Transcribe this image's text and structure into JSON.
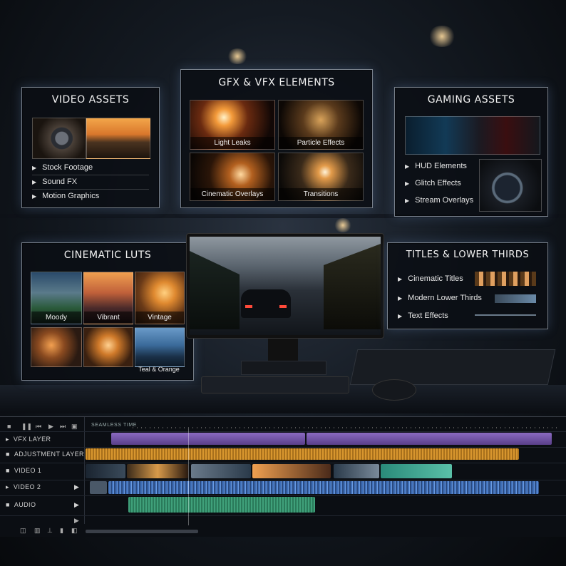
{
  "colors": {
    "accent": "#ffb25a",
    "panel_border": "#d2dceb",
    "vfx_clip": "#7b5fb0",
    "adjust_clip": "#c98a2a",
    "video2_clip": "#3f6fb8",
    "audio_clip": "#3fa07a"
  },
  "video_assets": {
    "title": "VIDEO ASSETS",
    "items": [
      "Stock Footage",
      "Sound FX",
      "Motion Graphics"
    ]
  },
  "gfx_vfx": {
    "title": "GFX & VFX ELEMENTS",
    "thumbs": [
      "Light Leaks",
      "Particle Effects",
      "Cinematic Overlays",
      "Transitions"
    ]
  },
  "gaming_assets": {
    "title": "GAMING ASSETS",
    "items": [
      "HUD Elements",
      "Glitch Effects",
      "Stream Overlays"
    ]
  },
  "cinematic_luts": {
    "title": "CINEMATIC LUTS",
    "thumbs": [
      "Moody",
      "Vibrant",
      "Vintage",
      "",
      "",
      "Teal & Orange"
    ]
  },
  "titles_lower_thirds": {
    "title": "TITLES & LOWER THIRDS",
    "items": [
      "Cinematic Titles",
      "Modern Lower Thirds",
      "Text Effects"
    ]
  },
  "timeline": {
    "header": "SEAMLESS TIME",
    "tracks": [
      "VFX LAYER",
      "ADJUSTMENT LAYER",
      "VIDEO 1",
      "VIDEO 2",
      "AUDIO"
    ],
    "transport_icons": [
      "stop-icon",
      "pause-icon",
      "step-back-icon",
      "play-icon",
      "step-forward-icon"
    ]
  }
}
